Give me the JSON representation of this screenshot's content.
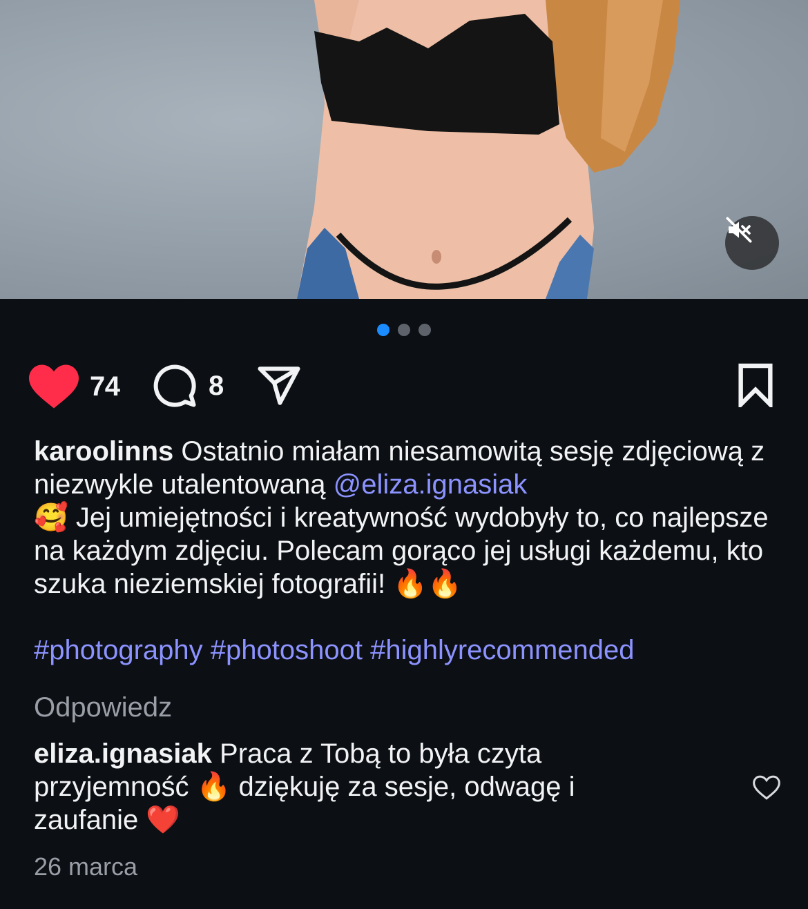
{
  "media": {
    "image_description_icon": "photo",
    "mute_icon": "speaker-muted-icon"
  },
  "carousel": {
    "count": 3,
    "active_index": 0
  },
  "actions": {
    "likes_count": "74",
    "comments_count": "8"
  },
  "post": {
    "username": "karoolinns",
    "caption_part1": " Ostatnio miałam niesamowitą sesję zdjęciową z niezwykle utalentowaną ",
    "mention": "@eliza.ignasiak",
    "emoji_smile": "🥰",
    "caption_part2": " Jej umiejętności i kreatywność wydobyły to, co najlepsze na każdym zdjęciu. Polecam gorąco jej usługi każdemu, kto szuka nieziemskiej fotografii! ",
    "emoji_fire": "🔥🔥",
    "hashtags": "#photography #photoshoot #highlyrecommended"
  },
  "reply_label": "Odpowiedz",
  "comment": {
    "username": "eliza.ignasiak",
    "text_part1": " Praca z Tobą to była czyta przyjemność ",
    "emoji_fire": "🔥",
    "text_part2": " dziękuję za sesje, odwagę i zaufanie ",
    "emoji_heart": "❤️",
    "date": "26 marca"
  },
  "colors": {
    "background": "#0c0f14",
    "like_red": "#ff2d4a",
    "link_blue": "#8c93ff",
    "muted_text": "#9a9ea6",
    "dot_active": "#1a8cff"
  }
}
